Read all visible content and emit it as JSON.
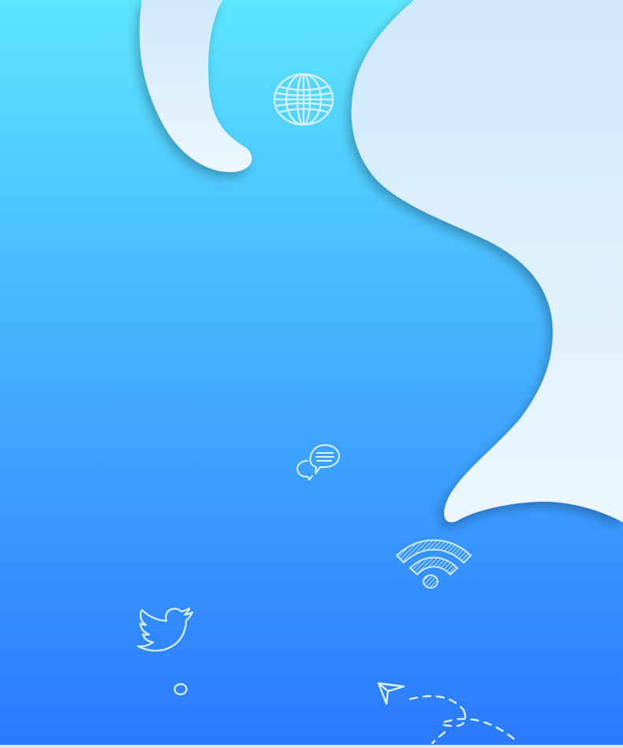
{
  "background": {
    "gradient_top": "#5de6fe",
    "gradient_bottom": "#2b79ff",
    "blob_color_top": "#cde7fa",
    "blob_color_bottom": "#eaf6fe"
  },
  "icons": [
    {
      "name": "globe-icon"
    },
    {
      "name": "chat-bubbles-icon"
    },
    {
      "name": "wifi-icon"
    },
    {
      "name": "twitter-bird-icon"
    },
    {
      "name": "small-circle-icon"
    },
    {
      "name": "paper-plane-trail-icon"
    }
  ],
  "icon_color": "#d8f1fd"
}
